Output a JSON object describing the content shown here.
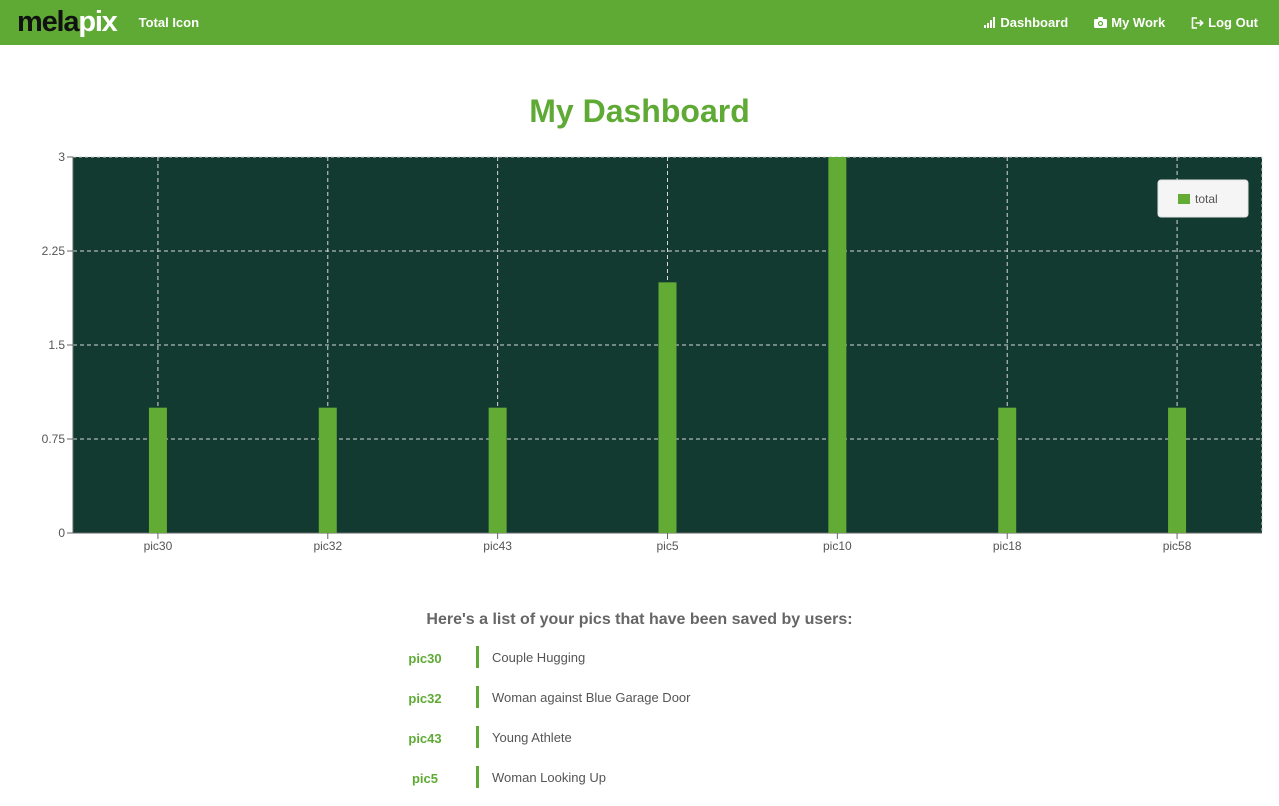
{
  "navbar": {
    "brand_part1": "mela",
    "brand_part2": "pix",
    "title": "Total Icon",
    "links": [
      {
        "label": "Dashboard",
        "icon": "bar-signal-icon"
      },
      {
        "label": "My Work",
        "icon": "camera-icon"
      },
      {
        "label": "Log Out",
        "icon": "log-out-icon"
      }
    ]
  },
  "page": {
    "title": "My Dashboard"
  },
  "colors": {
    "brand_green": "#5faa34",
    "plot_bg": "#123a31",
    "bar": "#62ab34"
  },
  "chart_data": {
    "type": "bar",
    "categories": [
      "pic30",
      "pic32",
      "pic43",
      "pic5",
      "pic10",
      "pic18",
      "pic58"
    ],
    "series": [
      {
        "name": "total",
        "values": [
          1,
          1,
          1,
          2,
          3,
          1,
          1
        ]
      }
    ],
    "y_ticks": [
      "0",
      "0.75",
      "1.5",
      "2.25",
      "3"
    ],
    "ylim": [
      0,
      3
    ],
    "grid": true,
    "legend_position": "top-right"
  },
  "saved_list": {
    "heading": "Here's a list of your pics that have been saved by users:",
    "items": [
      {
        "id": "pic30",
        "name": "Couple Hugging"
      },
      {
        "id": "pic32",
        "name": "Woman against Blue Garage Door"
      },
      {
        "id": "pic43",
        "name": "Young Athlete"
      },
      {
        "id": "pic5",
        "name": "Woman Looking Up"
      }
    ]
  }
}
